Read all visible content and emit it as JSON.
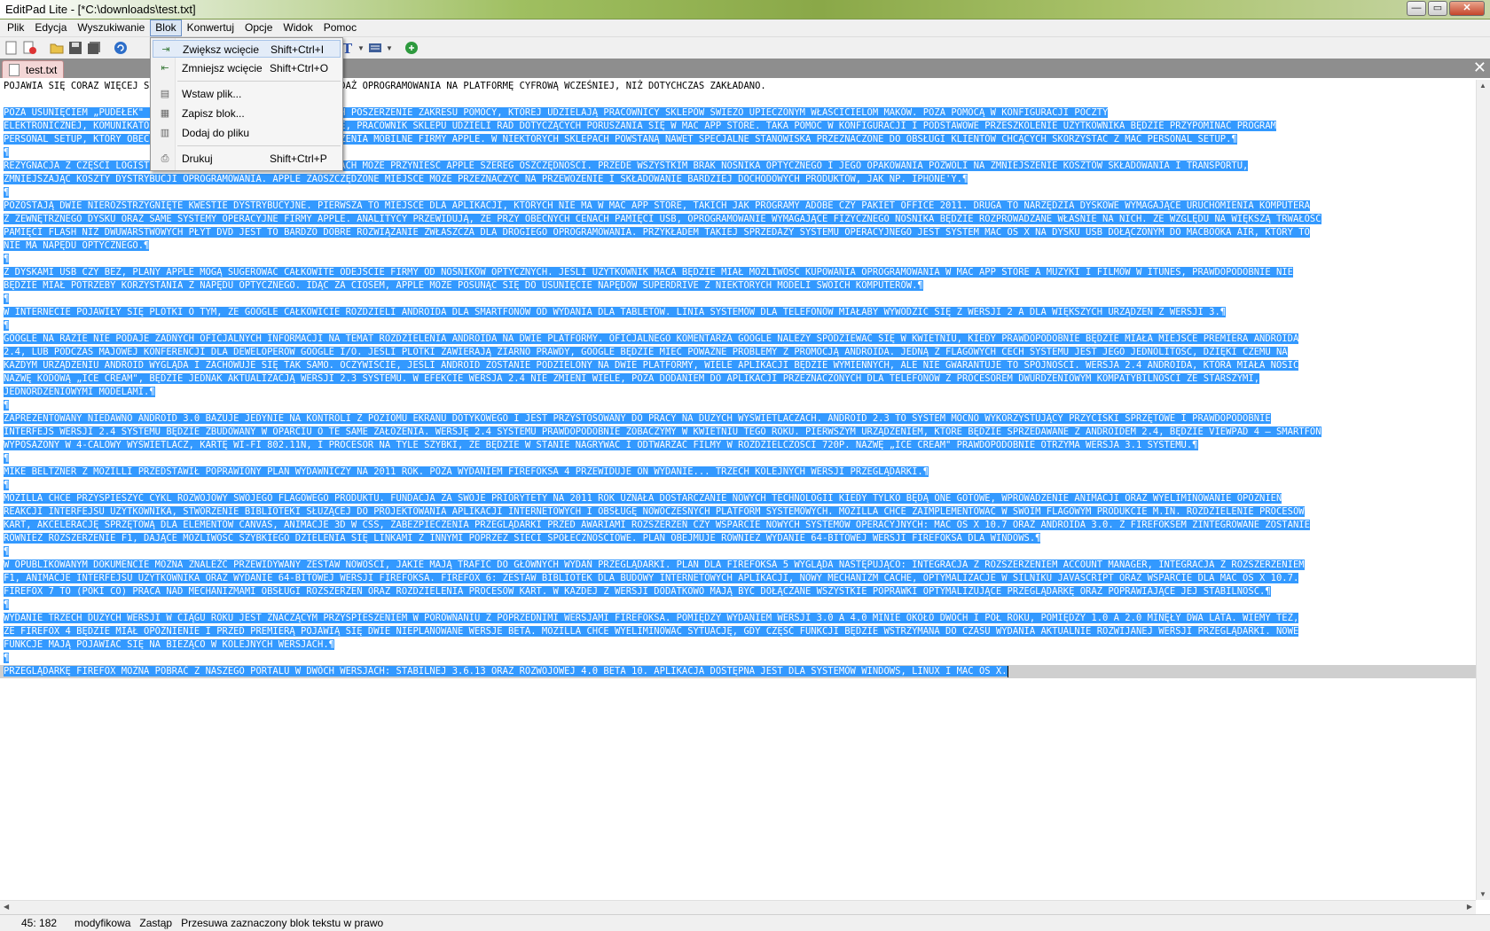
{
  "window": {
    "title": "EditPad Lite - [*C:\\downloads\\test.txt]",
    "minimize": "—",
    "maximize": "▭",
    "close": "✕"
  },
  "menubar": {
    "items": [
      "Plik",
      "Edycja",
      "Wyszukiwanie",
      "Blok",
      "Konwertuj",
      "Opcje",
      "Widok",
      "Pomoc"
    ],
    "active": "Blok"
  },
  "toolbar": {
    "icons": [
      "new-file-icon",
      "close-file-icon",
      "open-folder-icon",
      "save-icon",
      "save-all-icon",
      "undo-icon",
      "indent-icon",
      "font-icon",
      "format-icon",
      "web-icon"
    ]
  },
  "tab": {
    "label": "test.txt",
    "close": "✕"
  },
  "block_menu": {
    "items": [
      {
        "label": "Zwiększ wcięcie",
        "shortcut": "Shift+Ctrl+I"
      },
      {
        "label": "Zmniejsz wcięcie",
        "shortcut": "Shift+Ctrl+O"
      },
      {
        "label": "Wstaw plik...",
        "shortcut": ""
      },
      {
        "label": "Zapisz blok...",
        "shortcut": ""
      },
      {
        "label": "Dodaj do pliku",
        "shortcut": ""
      },
      {
        "label": "Drukuj",
        "shortcut": "Shift+Ctrl+P"
      }
    ]
  },
  "editor": {
    "lines": [
      {
        "pre": "POJAWIA SIĘ CORAZ WIĘCEJ",
        "text": "  SYGNAŁÓW, ŻE APPLE PRZENIESIE SPRZEDAŻ OPROGRAMOWANIA NA PLATFORMĘ CYFROWĄ WCZEŚNIEJ, NIŻ DOTYCHCZAS ZAKŁADANO.",
        "selected": false
      },
      {
        "text": "",
        "selected": false
      },
      {
        "text": "  POZA USUNIĘCIEM „PUDEŁEK\" Z PÓŁEK SKLEPÓW, APPLE MA W PLANACH POSZERZENIE ZAKRESU POMOCY, KTÓREJ UDZIELAJĄ PRACOWNICY SKLEPÓW ŚWIEŻO UPIECZONYM WŁAŚCICIELOM MAKÓW. POZA POMOCĄ W KONFIGURACJI POCZTY",
        "selected": true
      },
      {
        "text": "ELEKTRONICZNEJ, KOMUNIKATORA I DOSTĘPU DO SKLEPU ITUNES STORE, PRACOWNIK SKLEPU UDZIELI RAD DOTYCZĄCYCH PORUSZANIA SIĘ W MAC APP STORE. TAKA POMOC W KONFIGURACJI I PODSTAWOWE PRZESZKOLENIE UŻYTKOWNIKA BĘDZIE PRZYPOMINAĆ PROGRAM",
        "selected": true
      },
      {
        "text": "PERSONAL SETUP, KTÓRY OBECNIE OFEROWANY JEST KUPUJĄCYM URZĄDZENIA MOBILNE FIRMY APPLE. W NIEKTÓRYCH SKLEPACH POWSTANĄ NAWET SPECJALNE STANOWISKA PRZEZNACZONE DO OBSŁUGI KLIENTÓW CHCĄCYCH SKORZYSTAĆ Z MAC PERSONAL SETUP.¶",
        "selected": true
      },
      {
        "text": "¶",
        "selected": true
      },
      {
        "text": "  REZYGNACJA Z CZĘŚCI LOGISTYKI ZWIĄZANEJ Z OPAKOWANIA W SKLEPACH MOŻE PRZYNIEŚĆ APPLE SZEREG OSZCZĘDNOŚCI. PRZEDE WSZYSTKIM BRAK NOŚNIKA OPTYCZNEGO I JEGO OPAKOWANIA POZWOLI NA ZMNIEJSZENIE KOSZTÓW SKŁADOWANIA I TRANSPORTU,",
        "selected": true
      },
      {
        "text": "ZMNIEJSZAJĄC KOSZTY DYSTRYBUCJI OPROGRAMOWANIA. APPLE ZAOSZCZĘDZONE MIEJSCE MOŻE PRZEZNACZYĆ NA PRZEWOŻENIE I SKŁADOWANIE BARDZIEJ DOCHODOWYCH PRODUKTÓW, JAK NP. IPHONE'Y.¶",
        "selected": true
      },
      {
        "text": "¶",
        "selected": true
      },
      {
        "text": "  POZOSTAJĄ DWIE NIEROZSTRZYGNIĘTE KWESTIE DYSTRYBUCYJNE. PIERWSZA TO MIEJSCE DLA APLIKACJI, KTÓRYCH NIE MA W MAC APP STORE, TAKICH JAK PROGRAMY ADOBE CZY PAKIET OFFICE 2011. DRUGA TO NARZĘDZIA DYSKOWE WYMAGAJĄCE URUCHOMIENIA KOMPUTERA",
        "selected": true
      },
      {
        "text": "Z ZEWNĘTRZNEGO DYSKU ORAZ SAME SYSTEMY OPERACYJNE FIRMY APPLE. ANALITYCY PRZEWIDUJĄ, ŻE PRZY OBECNYCH CENACH PAMIĘCI USB, OPROGRAMOWANIE WYMAGAJĄCE FIZYCZNEGO NOŚNIKA BĘDZIE ROZPROWADZANE WŁAŚNIE NA NICH. ZE WZGLĘDU NA WIĘKSZĄ TRWAŁOŚĆ",
        "selected": true
      },
      {
        "text": "PAMIĘCI FLASH NIŻ DWUWARSTWOWYCH PŁYT DVD JEST TO BARDZO DOBRE ROZWIĄZANIE ZWŁASZCZA DLA DROGIEGO OPROGRAMOWANIA. PRZYKŁADEM TAKIEJ SPRZEDAŻY SYSTEMU OPERACYJNEGO JEST SYSTEM MAC OS X NA DYSKU USB DOŁĄCZONYM DO MACBOOKA AIR, KTÓRY TO",
        "selected": true
      },
      {
        "text": "NIE MA NAPĘDU OPTYCZNEGO.¶",
        "selected": true
      },
      {
        "text": "¶",
        "selected": true
      },
      {
        "text": "  Z DYSKAMI USB CZY BEZ, PLANY APPLE MOGĄ SUGEROWAĆ CAŁKOWITE ODEJŚCIE FIRMY OD NOŚNIKÓW OPTYCZNYCH. JEŚLI UŻYTKOWNIK MACA BĘDZIE MIAŁ MOŻLIWOŚĆ KUPOWANIA OPROGRAMOWANIA W MAC APP STORE A MUZYKI I FILMÓW W ITUNES, PRAWDOPODOBNIE NIE",
        "selected": true
      },
      {
        "text": "BĘDZIE MIAŁ POTRZEBY KORZYSTANIA Z NAPĘDU OPTYCZNEGO. IDĄC ZA CIOSEM, APPLE MOŻE POSUNĄĆ SIĘ DO USUNIĘCIE NAPĘDÓW SUPERDRIVE Z NIEKTÓRYCH MODELI SWOICH KOMPUTERÓW.¶",
        "selected": true
      },
      {
        "text": "¶",
        "selected": true
      },
      {
        "text": "  W INTERNECIE POJAWIŁY SIĘ PLOTKI O TYM, ŻE GOOGLE CAŁKOWICIE ROZDZIELI ANDROIDA DLA SMARTFONÓW OD WYDANIA DLA TABLETÓW. LINIA SYSTEMÓW DLA TELEFONÓW MIAŁABY WYWODZIĆ SIĘ Z WERSJI 2 A DLA WIĘKSZYCH URZĄDZEŃ Z WERSJI 3.¶",
        "selected": true
      },
      {
        "text": "¶",
        "selected": true
      },
      {
        "text": "  GOOGLE NA RAZIE NIE PODAJE ŻADNYCH OFICJALNYCH INFORMACJI NA TEMAT ROZDZIELENIA ANDROIDA NA DWIE PLATFORMY. OFICJALNEGO KOMENTARZA GOOGLE NALEŻY SPODZIEWAĆ SIĘ W KWIETNIU, KIEDY PRAWDOPODOBNIE BĘDZIE MIAŁA MIEJSCE PREMIERA ANDROIDA",
        "selected": true
      },
      {
        "text": "2.4, LUB PODCZAS MAJOWEJ KONFERENCJI DLA DEWELOPERÓW GOOGLE I/O. JEŚLI PLOTKI ZAWIERAJĄ ZIARNO PRAWDY, GOOGLE BĘDZIE MIEĆ POWAŻNE PROBLEMY Z PROMOCJĄ ANDROIDA. JEDNĄ Z FLAGOWYCH CECH SYSTEMU JEST JEGO JEDNOLITOŚĆ, DZIĘKI CZEMU NA",
        "selected": true
      },
      {
        "text": "KAŻDYM URZĄDZENIU ANDROID WYGLĄDA I ZACHOWUJE SIĘ TAK SAMO. OCZYWIŚCIE, JEŚLI ANDROID ZOSTANIE PODZIELONY NA DWIE PLATFORMY, WIELE APLIKACJI BĘDZIE WYMIENNYCH, ALE NIE GWARANTUJE TO SPÓJNOŚCI. WERSJA 2.4 ANDROIDA, KTÓRA MIAŁA NOSIĆ",
        "selected": true
      },
      {
        "text": "NAZWĘ KODOWĄ „ICE CREAM\", BĘDZIE JEDNAK AKTUALIZACJĄ WERSJI 2.3 SYSTEMU. W EFEKCIE WERSJA 2.4 NIE ZMIENI WIELE, POZA DODANIEM DO APLIKACJI PRZEZNACZONYCH DLA TELEFONÓW Z PROCESOREM DWURDZENIOWYM KOMPATYBILNOŚCI ZE STARSZYMI,",
        "selected": true
      },
      {
        "text": "JEDNORDZENIOWYMI MODELAMI.¶",
        "selected": true
      },
      {
        "text": "¶",
        "selected": true
      },
      {
        "text": "  ZAPREZENTOWANY NIEDAWNO ANDROID 3.0 BAZUJE JEDYNIE NA KONTROLI Z POZIOMU EKRANU DOTYKOWEGO I JEST PRZYSTOSOWANY DO PRACY NA DUŻYCH WYŚWIETLACZACH. ANDROID 2.3 TO SYSTEM MOCNO WYKORZYSTUJĄCY PRZYCISKI SPRZĘTOWE I PRAWDOPODOBNIE",
        "selected": true
      },
      {
        "text": "INTERFEJS WERSJI 2.4 SYSTEMU BĘDZIE ZBUDOWANY W OPARCIU O TE SAME ZAŁOŻENIA. WERSJĘ 2.4 SYSTEMU PRAWDOPODOBNIE ZOBACZYMY W KWIETNIU TEGO ROKU. PIERWSZYM URZĄDZENIEM, KTÓRE BĘDZIE SPRZEDAWANE Z ANDROIDEM 2.4, BĘDZIE VIEWPAD 4 – SMARTFON",
        "selected": true
      },
      {
        "text": "WYPOSAŻONY W 4-CALOWY WYŚWIETLACZ, KARTĘ WI-FI 802.11N, I PROCESOR NA TYLE SZYBKI, ŻE BĘDZIE W STANIE NAGRYWAĆ I ODTWARZAĆ FILMY W ROZDZIELCZOŚCI 720P. NAZWĘ „ICE CREAM\" PRAWDOPODOBNIE OTRZYMA WERSJA 3.1 SYSTEMU.¶",
        "selected": true
      },
      {
        "text": "¶",
        "selected": true
      },
      {
        "text": "  MIKE BELTZNER Z MOZILLI PRZEDSTAWIŁ POPRAWIONY PLAN WYDAWNICZY NA 2011 ROK. POZA WYDANIEM FIREFOKSA 4 PRZEWIDUJE ON WYDANIE... TRZECH KOLEJNYCH WERSJI PRZEGLĄDARKI.¶",
        "selected": true
      },
      {
        "text": "¶",
        "selected": true
      },
      {
        "text": "  MOZILLA CHCE PRZYSPIESZYĆ CYKL ROZWOJOWY SWOJEGO FLAGOWEGO PRODUKTU. FUNDACJA ZA SWOJE PRIORYTETY NA 2011 ROK UZNAŁA DOSTARCZANIE NOWYCH TECHNOLOGII KIEDY TYLKO BĘDĄ ONE GOTOWE, WPROWADZENIE ANIMACJI ORAZ WYELIMINOWANIE OPÓŹNIEŃ",
        "selected": true
      },
      {
        "text": "REAKCJI INTERFEJSU UŻYTKOWNIKA, STWORZENIE BIBLIOTEKI SŁUŻĄCEJ DO PROJEKTOWANIA APLIKACJI INTERNETOWYCH I OBSŁUGĘ NOWOCZESNYCH PLATFORM SYSTEMOWYCH. MOZILLA CHCE ZAIMPLEMENTOWAĆ W SWOIM FLAGOWYM PRODUKCIE M.IN. ROZDZIELENIE PROCESÓW",
        "selected": true
      },
      {
        "text": "KART, AKCELERACJĘ SPRZĘTOWĄ DLA ELEMENTÓW CANVAS, ANIMACJE 3D W CSS, ZABEZPIECZENIA PRZEGLĄDARKI PRZED AWARIAMI ROZSZERZEŃ CZY WSPARCIE NOWYCH SYSTEMÓW OPERACYJNYCH: MAC OS X 10.7 ORAZ ANDROIDA 3.0. Z FIREFOKSEM ZINTEGROWANE ZOSTANIE",
        "selected": true
      },
      {
        "text": "RÓWNIEŻ ROZSZERZENIE F1, DAJĄCE MOŻLIWOŚĆ SZYBKIEGO DZIELENIA SIĘ LINKAMI Z INNYMI POPRZEZ SIECI SPOŁECZNOŚCIOWE. PLAN OBEJMUJE RÓWNIEŻ WYDANIE 64-BITOWEJ WERSJI FIREFOKSA DLA WINDOWS.¶",
        "selected": true
      },
      {
        "text": "¶",
        "selected": true
      },
      {
        "text": "  W OPUBLIKOWANYM DOKUMENCIE MOŻNA ZNALEŹĆ PRZEWIDYWANY ZESTAW NOWOŚCI, JAKIE MAJĄ TRAFIĆ DO GŁÓWNYCH WYDAŃ PRZEGLĄDARKI. PLAN DLA FIREFOKSA 5 WYGLĄDA NASTĘPUJĄCO: INTEGRACJA Z ROZSZERZENIEM ACCOUNT MANAGER, INTEGRACJA Z ROZSZERZENIEM",
        "selected": true
      },
      {
        "text": "F1, ANIMACJE INTERFEJSU UŻYTKOWNIKA ORAZ WYDANIE 64-BITOWEJ WERSJI FIREFOKSA. FIREFOX 6: ZESTAW BIBLIOTEK DLA BUDOWY INTERNETOWYCH APLIKACJI, NOWY MECHANIZM CACHE, OPTYMALIZACJE W SILNIKU JAVASCRIPT ORAZ WSPARCIE DLA MAC OS X 10.7.",
        "selected": true
      },
      {
        "text": "FIREFOX 7 TO (PÓKI CO) PRACA NAD MECHANIZMAMI OBSŁUGI ROZSZERZEŃ ORAZ ROZDZIELENIA PROCESÓW KART. W KAŻDEJ Z WERSJI DODATKOWO MAJĄ BYĆ DOŁĄCZANE WSZYSTKIE POPRAWKI OPTYMALIZUJĄCE PRZEGLĄDARKĘ ORAZ POPRAWIAJĄCE JEJ STABILNOŚĆ.¶",
        "selected": true
      },
      {
        "text": "¶",
        "selected": true
      },
      {
        "text": "  WYDANIE TRZECH DUŻYCH WERSJI W CIĄGU ROKU JEST ZNACZĄCYM PRZYSPIESZENIEM W PORÓWNANIU Z POPRZEDNIMI WERSJAMI FIREFOKSA. POMIĘDZY WYDANIEM WERSJI 3.0 A 4.0 MINIE OKOŁO DWÓCH I PÓŁ ROKU, POMIĘDZY 1.0 A 2.0 MINĘŁY DWA LATA. WIEMY TEŻ,",
        "selected": true
      },
      {
        "text": "ŻE FIREFOX 4 BĘDZIE MIAŁ OPÓŹNIENIE I PRZED PREMIERĄ POJAWIĄ SIĘ DWIE NIEPLANOWANE WERSJE BETA. MOZILLA CHCE WYELIMINOWAĆ SYTUACJĘ, GDY CZĘŚĆ FUNKCJI BĘDZIE WSTRZYMANA DO CZASU WYDANIA AKTUALNIE ROZWIJANEJ WERSJI PRZEGLĄDARKI. NOWE",
        "selected": true
      },
      {
        "text": "FUNKCJE MAJĄ POJAWIAĆ SIĘ NA BIEŻĄCO W KOLEJNYCH WERSJACH.¶",
        "selected": true
      },
      {
        "text": "¶",
        "selected": true
      },
      {
        "text": "  PRZEGLĄDARKĘ FIREFOX MOŻNA POBRAĆ Z NASZEGO PORTALU W DWÓCH WERSJACH: STABILNEJ 3.6.13 ORAZ ROZWOJOWEJ 4.0 BETA 10. APLIKACJA DOSTĘPNA JEST DLA SYSTEMÓW WINDOWS, LINUX I MAC OS X.",
        "selected": true,
        "last": true
      }
    ]
  },
  "statusbar": {
    "position": "45: 182",
    "modified": "modyfikowa",
    "mode": "Zastąp",
    "hint": "Przesuwa zaznaczony blok tekstu w prawo"
  },
  "colors": {
    "selection": "#3399ff",
    "titlebar": "#8aa848",
    "tab": "#f3d6d6"
  }
}
